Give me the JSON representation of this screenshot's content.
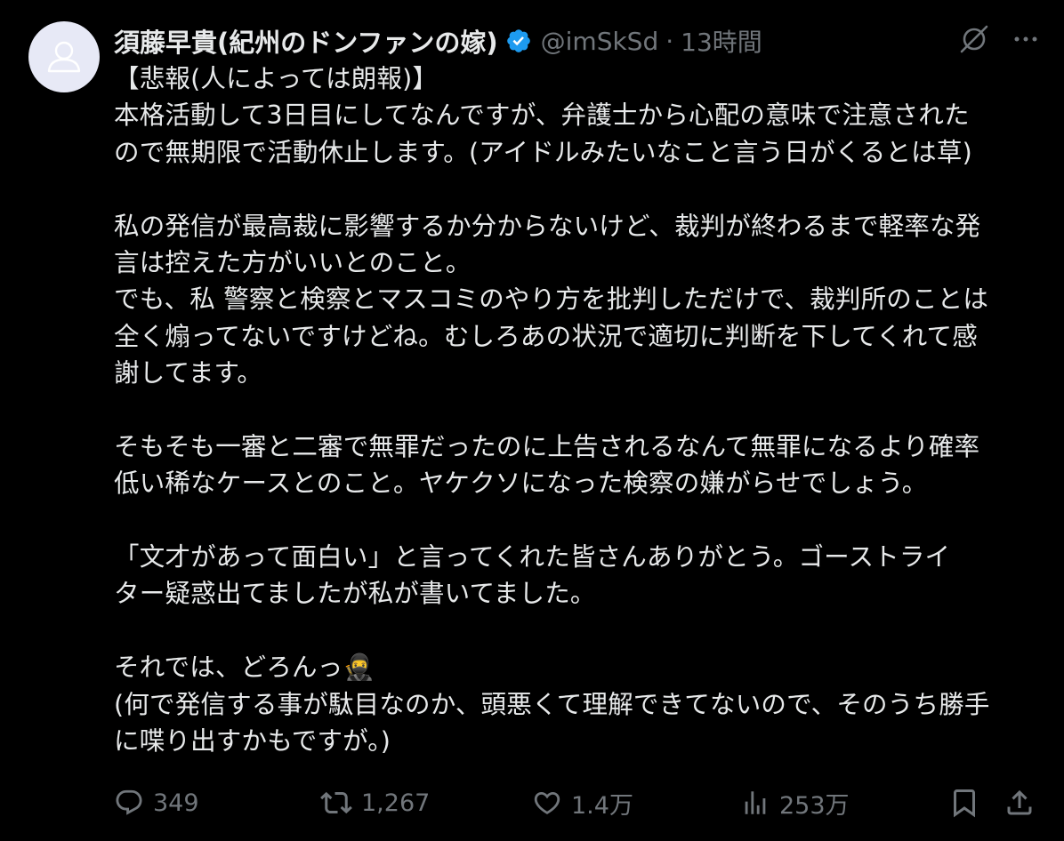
{
  "tweet": {
    "display_name": "須藤早貴(紀州のドンファンの嫁)",
    "handle": "@imSkSd",
    "separator": "·",
    "time": "13時間",
    "lines": [
      "【悲報(人によっては朗報)】",
      "本格活動して3日目にしてなんですが、弁護士から心配の意味で注意された",
      "ので無期限で活動休止します。(アイドルみたいなこと言う日がくるとは草)",
      "",
      "私の発信が最高裁に影響するか分からないけど、裁判が終わるまで軽率な発",
      "言は控えた方がいいとのこと。",
      "でも、私 警察と検察とマスコミのやり方を批判しただけで、裁判所のことは",
      "全く煽ってないですけどね。むしろあの状況で適切に判断を下してくれて感",
      "謝してます。",
      "",
      "そもそも一審と二審で無罪だったのに上告されるなんて無罪になるより確率",
      "低い稀なケースとのこと。ヤケクソになった検察の嫌がらせでしょう。",
      "",
      "「文才があって面白い」と言ってくれた皆さんありがとう。ゴーストライ",
      "ター疑惑出てましたが私が書いてました。",
      "",
      "それでは、どろんっ🥷",
      "(何で発信する事が駄目なのか、頭悪くて理解できてないので、そのうち勝手",
      "に喋り出すかもですが。)"
    ]
  },
  "stats": {
    "replies": "349",
    "retweets": "1,267",
    "likes": "1.4万",
    "views": "253万"
  },
  "icons": {
    "avatar": "default-user-icon",
    "verified": "verified-badge-icon",
    "grok": "grok-icon",
    "more": "more-icon",
    "reply": "reply-icon",
    "retweet": "retweet-icon",
    "like": "like-icon",
    "views": "views-icon",
    "bookmark": "bookmark-icon",
    "share": "share-icon"
  },
  "colors": {
    "background": "#000000",
    "text": "#e7e9ea",
    "muted": "#71767b",
    "verified": "#1d9bf0",
    "avatar_bg": "#e7e9f6"
  }
}
